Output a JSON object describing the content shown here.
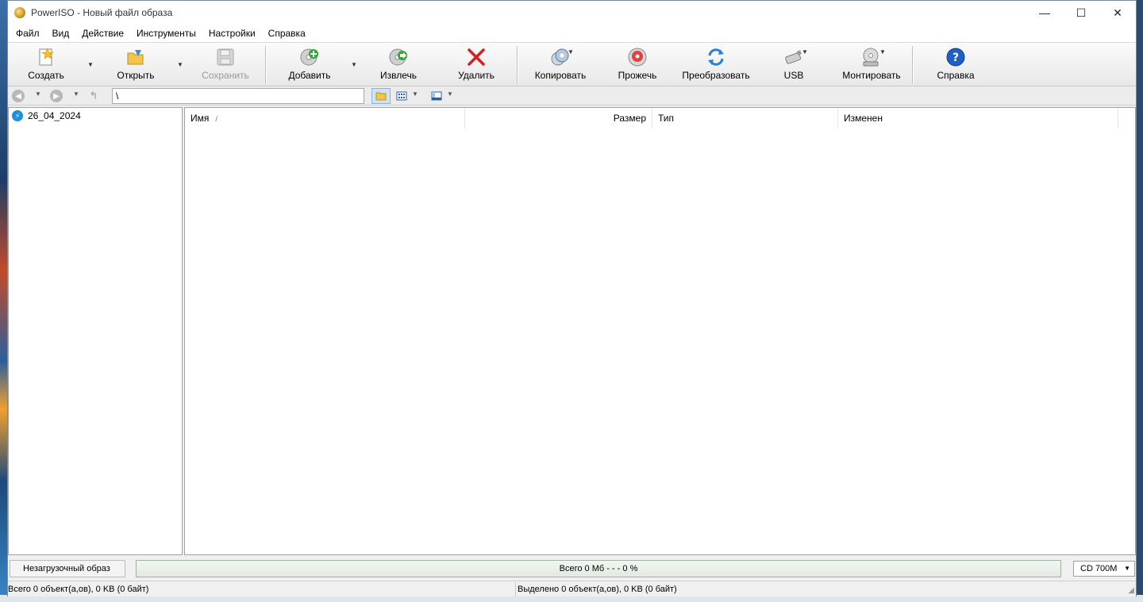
{
  "window": {
    "title": "PowerISO - Новый файл образа",
    "minimize_label": "—",
    "maximize_label": "☐",
    "close_label": "✕"
  },
  "menu": [
    "Файл",
    "Вид",
    "Действие",
    "Инструменты",
    "Настройки",
    "Справка"
  ],
  "toolbar": {
    "create": "Создать",
    "open": "Открыть",
    "save": "Сохранить",
    "add": "Добавить",
    "extract": "Извлечь",
    "delete": "Удалить",
    "copy": "Копировать",
    "burn": "Прожечь",
    "convert": "Преобразовать",
    "usb": "USB",
    "mount": "Монтировать",
    "help": "Справка"
  },
  "nav": {
    "path": "\\"
  },
  "tree": {
    "root": "26_04_2024"
  },
  "list": {
    "columns": {
      "name": "Имя",
      "size": "Размер",
      "type": "Тип",
      "modified": "Изменен"
    },
    "sort_indicator": "/"
  },
  "status": {
    "boot_type": "Незагрузочный образ",
    "total_progress": "Всего  0 Мб   - - -  0 %",
    "media": "CD 700M",
    "total_objects": "Всего 0 объект(а,ов), 0 KB (0 байт)",
    "selected_objects": "Выделено 0 объект(а,ов), 0 KB (0 байт)"
  },
  "colors": {
    "accent_blue": "#1f8fe0",
    "delete_red": "#d42020",
    "add_green": "#2faa2f"
  }
}
